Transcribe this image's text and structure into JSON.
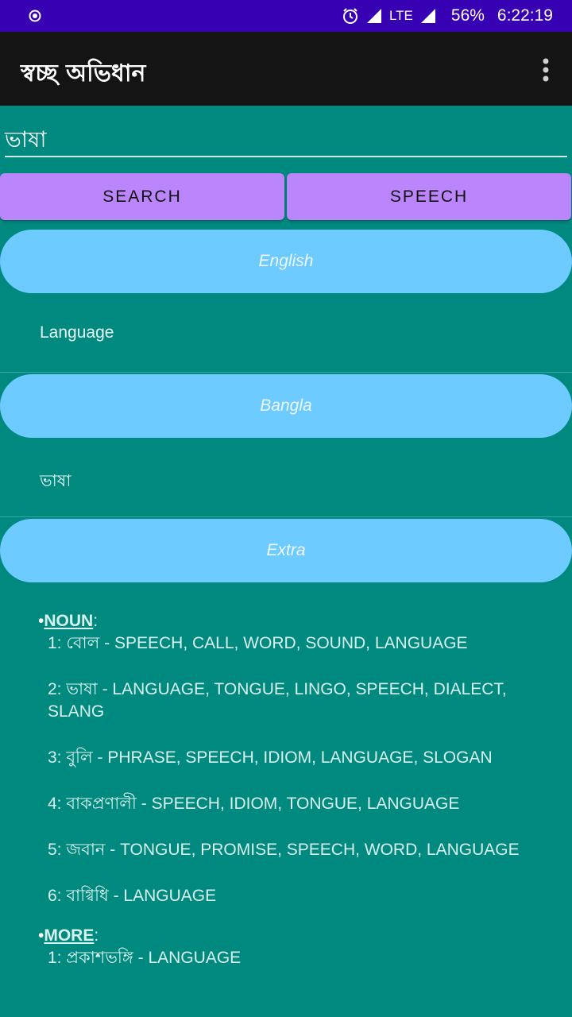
{
  "status_bar": {
    "battery": "56%",
    "time": "6:22:19",
    "network": "LTE"
  },
  "app_bar": {
    "title": "স্বচ্ছ অভিধান"
  },
  "search": {
    "value": "ভাষা",
    "search_label": "SEARCH",
    "speech_label": "SPEECH"
  },
  "sections": {
    "english": {
      "header": "English",
      "value": "Language"
    },
    "bangla": {
      "header": "Bangla",
      "value": "ভাষা"
    },
    "extra": {
      "header": "Extra"
    }
  },
  "extra": {
    "noun": {
      "label": "NOUN",
      "entries": [
        "1: বোল - SPEECH, CALL, WORD, SOUND, LANGUAGE",
        "2: ভাষা - LANGUAGE, TONGUE, LINGO, SPEECH, DIALECT, SLANG",
        "3: বুলি - PHRASE, SPEECH, IDIOM, LANGUAGE, SLOGAN",
        "4: বাকপ্রণালী - SPEECH, IDIOM, TONGUE, LANGUAGE",
        "5: জবান - TONGUE, PROMISE, SPEECH, WORD, LANGUAGE",
        "6: বাগ্বিধি - LANGUAGE"
      ]
    },
    "more": {
      "label": "MORE",
      "entries": [
        "1: প্রকাশভঙ্গি - LANGUAGE"
      ]
    }
  }
}
